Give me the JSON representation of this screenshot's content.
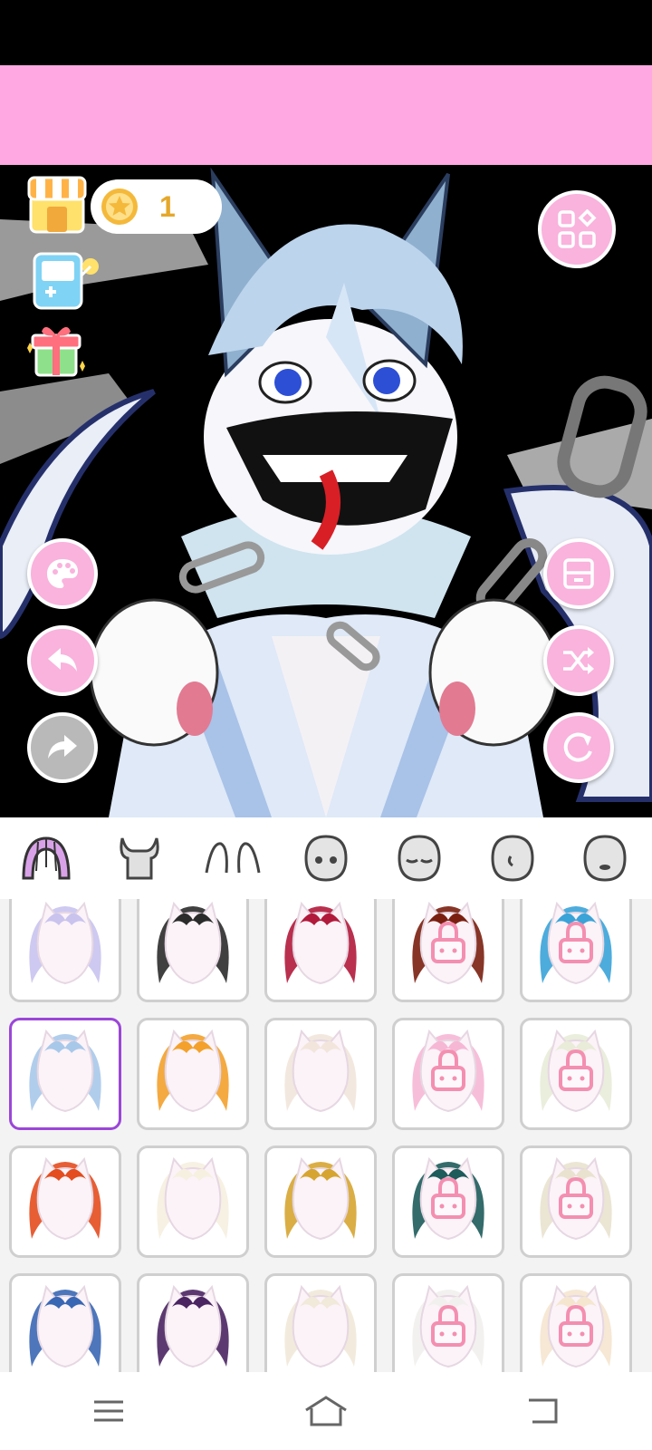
{
  "coins": {
    "value": "1"
  },
  "toolbar": {
    "shop_icon": "shop-icon",
    "game_icon": "game-icon",
    "gift_icon": "gift-icon",
    "menu_icon": "grid-menu-icon"
  },
  "side_actions": {
    "palette": "palette-icon",
    "undo": "undo-icon",
    "redo": "redo-icon",
    "save": "save-icon",
    "shuffle": "shuffle-icon",
    "reset": "reset-icon"
  },
  "categories": [
    {
      "name": "hair",
      "active": true
    },
    {
      "name": "horns",
      "active": false
    },
    {
      "name": "ears",
      "active": false
    },
    {
      "name": "face-eyes",
      "active": false
    },
    {
      "name": "face-closed",
      "active": false
    },
    {
      "name": "face-side",
      "active": false
    },
    {
      "name": "face-mouth",
      "active": false
    }
  ],
  "hair_items": [
    {
      "color": "#c9c3ee",
      "locked": false
    },
    {
      "color": "#2b2b2b",
      "locked": false
    },
    {
      "color": "#b11a3b",
      "locked": false
    },
    {
      "color": "#7a1f10",
      "locked": true
    },
    {
      "color": "#3aa3d8",
      "locked": true
    },
    {
      "color": "#a8c8ea",
      "locked": false,
      "selected": true
    },
    {
      "color": "#f3a12c",
      "locked": false
    },
    {
      "color": "#f2e6dc",
      "locked": false
    },
    {
      "color": "#f6b7d5",
      "locked": true
    },
    {
      "color": "#e8ecd8",
      "locked": true
    },
    {
      "color": "#e44d1f",
      "locked": false
    },
    {
      "color": "#f6f0e0",
      "locked": false
    },
    {
      "color": "#d6a531",
      "locked": false
    },
    {
      "color": "#1e5b5b",
      "locked": true
    },
    {
      "color": "#e9e2cf",
      "locked": true
    },
    {
      "color": "#3a67b4",
      "locked": false
    },
    {
      "color": "#4a2562",
      "locked": false
    },
    {
      "color": "#f1e9d9",
      "locked": false
    },
    {
      "color": "#f2f0ee",
      "locked": true
    },
    {
      "color": "#f5e6cf",
      "locked": true
    }
  ],
  "colors": {
    "accent_pink": "#f9b3dd",
    "banner_pink": "#ffa8e2",
    "coin_gold": "#e5a82a",
    "selected_border": "#9b46d8"
  },
  "nav": {
    "menu": "menu-icon",
    "home": "home-icon",
    "back": "back-icon"
  }
}
